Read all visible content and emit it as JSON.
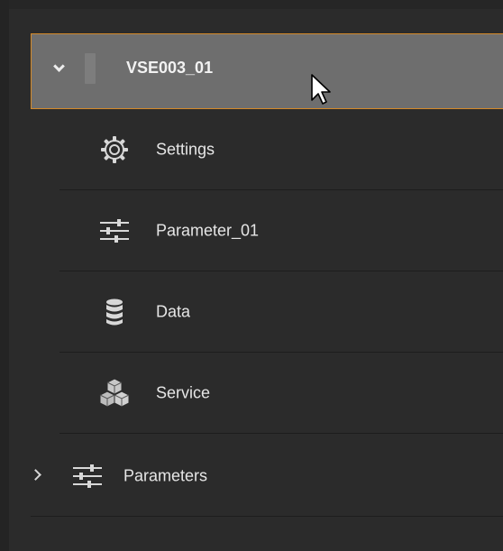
{
  "tree": {
    "device": {
      "label": "VSE003_01",
      "expanded": true,
      "selected": true,
      "icon": "device-icon",
      "children": [
        {
          "label": "Settings",
          "icon": "gear-icon"
        },
        {
          "label": "Parameter_01",
          "icon": "sliders-icon"
        },
        {
          "label": "Data",
          "icon": "database-icon"
        },
        {
          "label": "Service",
          "icon": "cubes-icon"
        }
      ]
    },
    "parameters": {
      "label": "Parameters",
      "expanded": false,
      "icon": "sliders-icon"
    }
  },
  "colors": {
    "background": "#2b2b2b",
    "selected_background": "#6e6e6e",
    "selected_border": "#d48a2a",
    "text": "#e6e6e6"
  }
}
